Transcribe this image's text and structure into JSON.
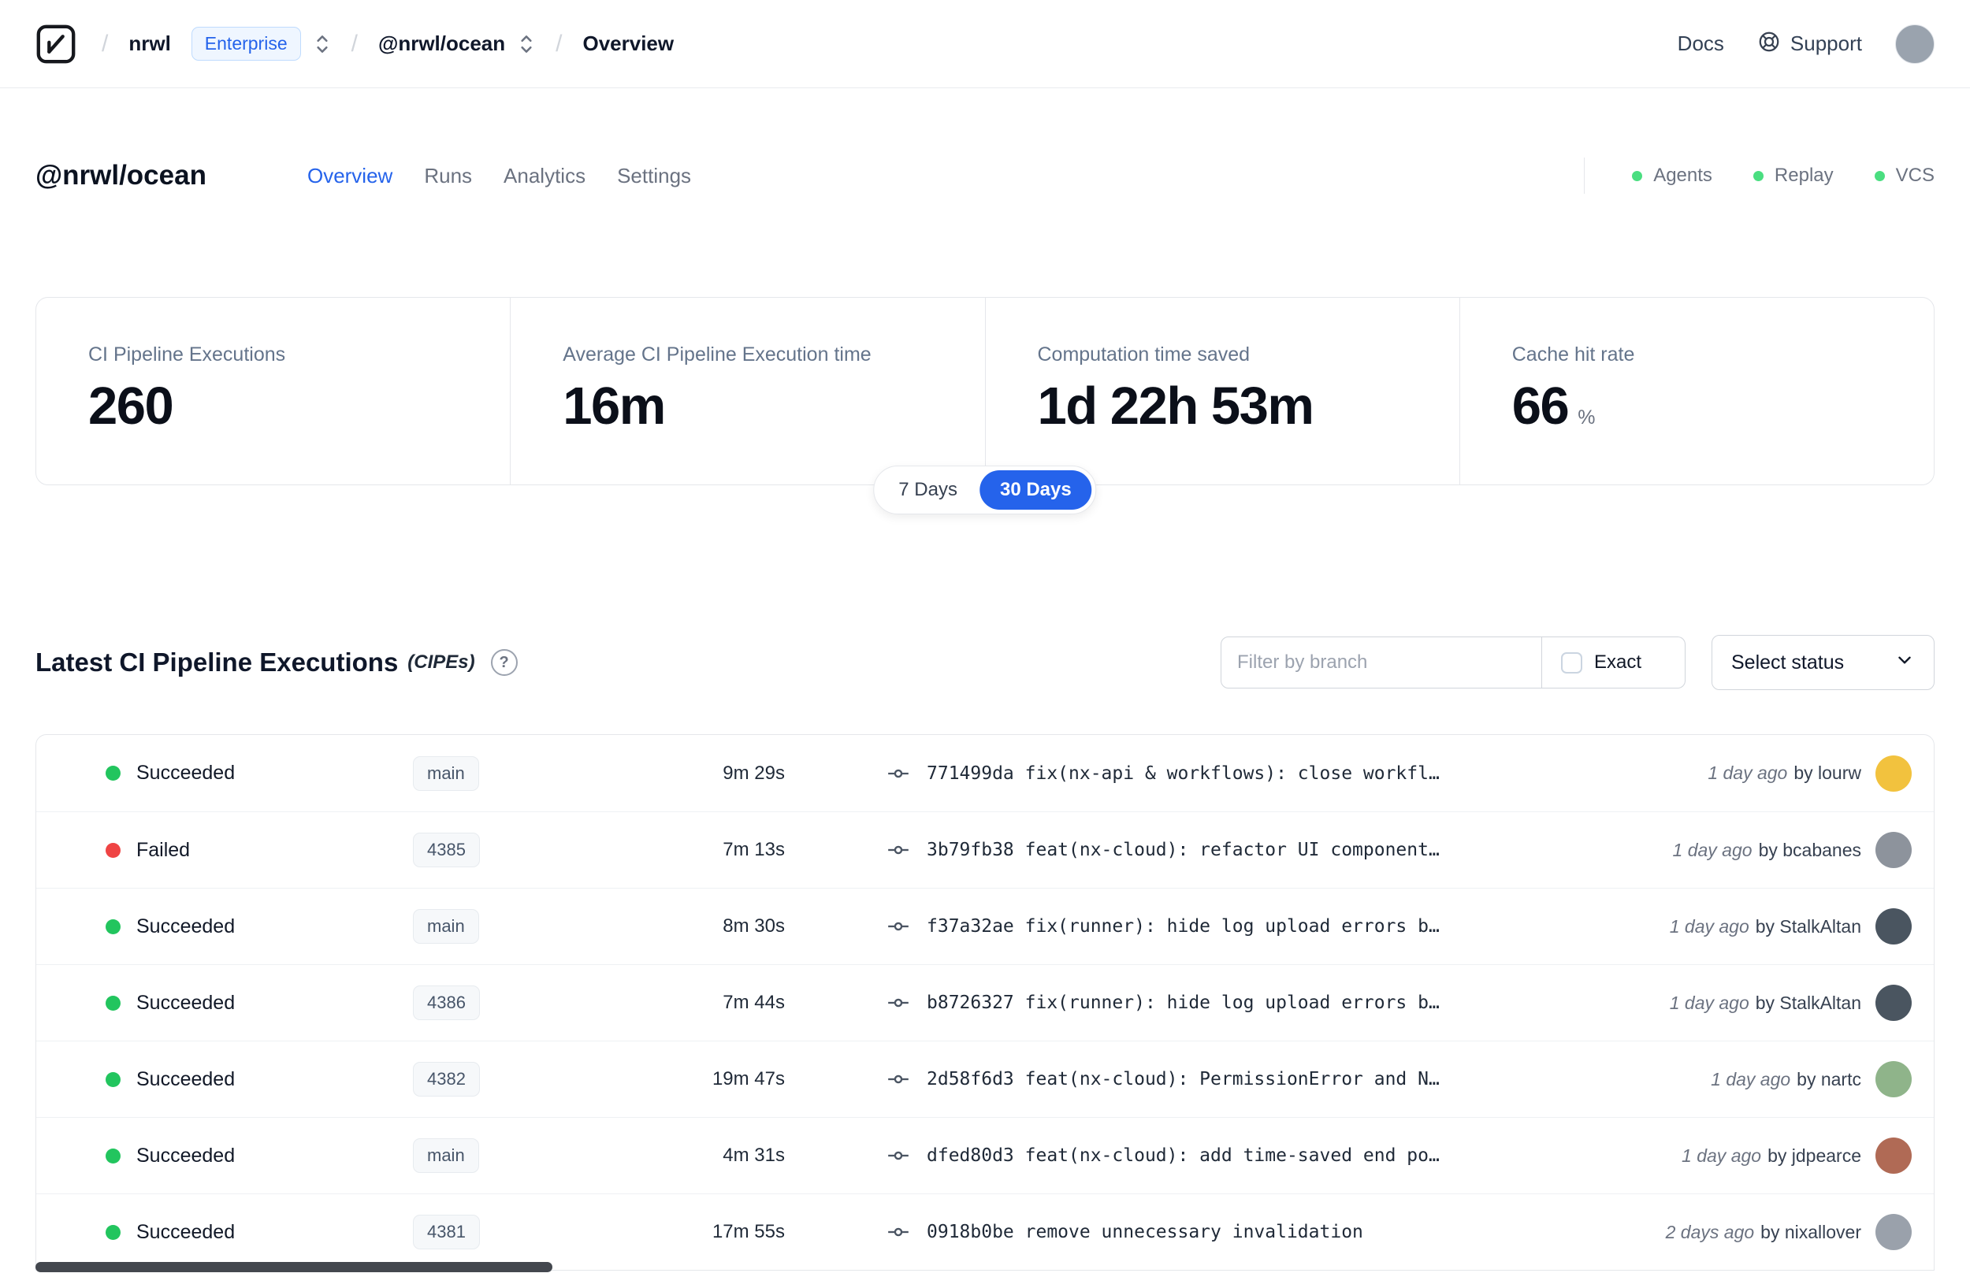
{
  "navbar": {
    "separator": "/",
    "org": "nrwl",
    "org_badge": "Enterprise",
    "workspace": "@nrwl/ocean",
    "page": "Overview",
    "docs": "Docs",
    "support": "Support",
    "avatar_color": "#9aa3ae"
  },
  "header": {
    "title": "@nrwl/ocean",
    "tabs": [
      {
        "label": "Overview"
      },
      {
        "label": "Runs"
      },
      {
        "label": "Analytics"
      },
      {
        "label": "Settings"
      }
    ],
    "statuses": [
      {
        "label": "Agents",
        "color": "#4ade80"
      },
      {
        "label": "Replay",
        "color": "#4ade80"
      },
      {
        "label": "VCS",
        "color": "#4ade80"
      }
    ]
  },
  "stats": {
    "cards": [
      {
        "label": "CI Pipeline Executions",
        "value": "260",
        "suffix": ""
      },
      {
        "label": "Average CI Pipeline Execution time",
        "value": "16m",
        "suffix": ""
      },
      {
        "label": "Computation time saved",
        "value": "1d 22h 53m",
        "suffix": ""
      },
      {
        "label": "Cache hit rate",
        "value": "66",
        "suffix": "%"
      }
    ],
    "range": [
      "7 Days",
      "30 Days"
    ],
    "range_selected": "30 Days"
  },
  "cipes": {
    "title": "Latest CI Pipeline Executions",
    "suffix": "(CIPEs)",
    "help_glyph": "?",
    "filter_placeholder": "Filter by branch",
    "exact_label": "Exact",
    "select_status_label": "Select status",
    "rows": [
      {
        "status": "Succeeded",
        "status_color": "#22c55e",
        "branch": "main",
        "duration": "9m 29s",
        "commit": "771499da fix(nx-api & workflows): close workfl…",
        "time": "1 day ago",
        "author": "by lourw",
        "avatar_color": "#f2c23e"
      },
      {
        "status": "Failed",
        "status_color": "#ef4444",
        "branch": "4385",
        "duration": "7m 13s",
        "commit": "3b79fb38 feat(nx-cloud): refactor UI component…",
        "time": "1 day ago",
        "author": "by bcabanes",
        "avatar_color": "#8d939c"
      },
      {
        "status": "Succeeded",
        "status_color": "#22c55e",
        "branch": "main",
        "duration": "8m 30s",
        "commit": "f37a32ae fix(runner): hide log upload errors b…",
        "time": "1 day ago",
        "author": "by StalkAltan",
        "avatar_color": "#4a5560"
      },
      {
        "status": "Succeeded",
        "status_color": "#22c55e",
        "branch": "4386",
        "duration": "7m 44s",
        "commit": "b8726327 fix(runner): hide log upload errors b…",
        "time": "1 day ago",
        "author": "by StalkAltan",
        "avatar_color": "#4a5560"
      },
      {
        "status": "Succeeded",
        "status_color": "#22c55e",
        "branch": "4382",
        "duration": "19m 47s",
        "commit": "2d58f6d3 feat(nx-cloud): PermissionError and N…",
        "time": "1 day ago",
        "author": "by nartc",
        "avatar_color": "#8fb48a"
      },
      {
        "status": "Succeeded",
        "status_color": "#22c55e",
        "branch": "main",
        "duration": "4m 31s",
        "commit": "dfed80d3 feat(nx-cloud): add time-saved end po…",
        "time": "1 day ago",
        "author": "by jdpearce",
        "avatar_color": "#b06a55"
      },
      {
        "status": "Succeeded",
        "status_color": "#22c55e",
        "branch": "4381",
        "duration": "17m 55s",
        "commit": "0918b0be remove unnecessary invalidation",
        "time": "2 days ago",
        "author": "by nixallover",
        "avatar_color": "#9aa1ab"
      }
    ]
  },
  "colors": {
    "accent": "#2563eb",
    "success": "#22c55e",
    "failure": "#ef4444"
  }
}
